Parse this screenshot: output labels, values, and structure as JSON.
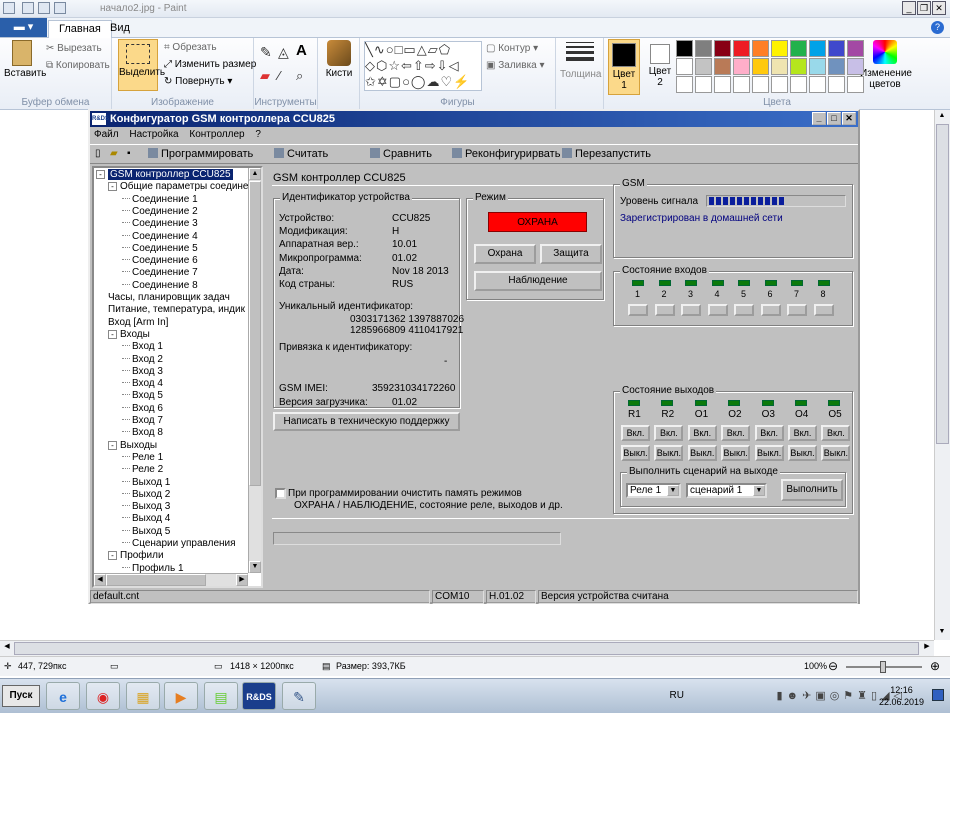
{
  "paint": {
    "title": "начало2.jpg - Paint",
    "file_tab": "▬ ▾",
    "tabs": [
      "Главная",
      "Вид"
    ],
    "clipboard": {
      "paste": "Вставить",
      "cut": "Вырезать",
      "copy": "Копировать",
      "group": "Буфер обмена"
    },
    "image": {
      "select": "Выделить",
      "crop": "Обрезать",
      "resize": "Изменить размер",
      "rotate": "Повернуть",
      "group": "Изображение"
    },
    "tools": {
      "group": "Инструменты",
      "brushes": "Кисти"
    },
    "shapes": {
      "group": "Фигуры",
      "outline": "Контур",
      "fill": "Заливка"
    },
    "size": "Толщина",
    "color1": {
      "label": "Цвет",
      "num": "1"
    },
    "color2": {
      "label": "Цвет",
      "num": "2"
    },
    "colors_group": "Цвета",
    "edit_colors": "Изменение цветов",
    "palette": [
      "#000000",
      "#7f7f7f",
      "#880015",
      "#ed1c24",
      "#ff7f27",
      "#fff200",
      "#22b14c",
      "#00a2e8",
      "#3f48cc",
      "#a349a4",
      "#ffffff",
      "#c3c3c3",
      "#b97a57",
      "#ffaec9",
      "#ffc90e",
      "#efe4b0",
      "#b5e61d",
      "#99d9ea",
      "#7092be",
      "#c8bfe7",
      "#ffffff",
      "#ffffff",
      "#ffffff",
      "#ffffff",
      "#ffffff",
      "#ffffff",
      "#ffffff",
      "#ffffff",
      "#ffffff",
      "#ffffff"
    ],
    "status": {
      "pos": "447, 729пкс",
      "size": "1418 × 1200пкс",
      "filesize": "Размер: 393,7КБ",
      "zoom": "100%"
    }
  },
  "taskbar": {
    "start": "Пуск",
    "lang": "RU",
    "time": "12:16",
    "date": "22.06.2019",
    "active_app": "R&DS"
  },
  "cfg": {
    "title": "Конфигуратор GSM контроллера CCU825",
    "menu": [
      "Файл",
      "Настройка",
      "Контроллер",
      "?"
    ],
    "toolbar": {
      "program": "Программировать",
      "read": "Считать",
      "compare": "Сравнить",
      "reconfigure": "Реконфигурирвать",
      "restart": "Перезапустить"
    },
    "tree": [
      {
        "t": "GSM контроллер CCU825",
        "lvl": 0,
        "sel": true,
        "exp": "-"
      },
      {
        "t": "Общие параметры соединени",
        "lvl": 1,
        "exp": "-"
      },
      {
        "t": "Соединение 1",
        "lvl": 2
      },
      {
        "t": "Соединение 2",
        "lvl": 2
      },
      {
        "t": "Соединение 3",
        "lvl": 2
      },
      {
        "t": "Соединение 4",
        "lvl": 2
      },
      {
        "t": "Соединение 5",
        "lvl": 2
      },
      {
        "t": "Соединение 6",
        "lvl": 2
      },
      {
        "t": "Соединение 7",
        "lvl": 2
      },
      {
        "t": "Соединение 8",
        "lvl": 2
      },
      {
        "t": "Часы, планировщик задач",
        "lvl": 1
      },
      {
        "t": "Питание, температура, индик",
        "lvl": 1
      },
      {
        "t": "Вход [Arm In]",
        "lvl": 1
      },
      {
        "t": "Входы",
        "lvl": 1,
        "exp": "-"
      },
      {
        "t": "Вход 1",
        "lvl": 2
      },
      {
        "t": "Вход 2",
        "lvl": 2
      },
      {
        "t": "Вход 3",
        "lvl": 2
      },
      {
        "t": "Вход 4",
        "lvl": 2
      },
      {
        "t": "Вход 5",
        "lvl": 2
      },
      {
        "t": "Вход 6",
        "lvl": 2
      },
      {
        "t": "Вход 7",
        "lvl": 2
      },
      {
        "t": "Вход 8",
        "lvl": 2
      },
      {
        "t": "Выходы",
        "lvl": 1,
        "exp": "-"
      },
      {
        "t": "Реле 1",
        "lvl": 2
      },
      {
        "t": "Реле 2",
        "lvl": 2
      },
      {
        "t": "Выход 1",
        "lvl": 2
      },
      {
        "t": "Выход 2",
        "lvl": 2
      },
      {
        "t": "Выход 3",
        "lvl": 2
      },
      {
        "t": "Выход 4",
        "lvl": 2
      },
      {
        "t": "Выход 5",
        "lvl": 2
      },
      {
        "t": "Сценарии управления",
        "lvl": 2
      },
      {
        "t": "Профили",
        "lvl": 1,
        "exp": "-"
      },
      {
        "t": "Профиль 1",
        "lvl": 2
      }
    ],
    "header": "GSM контроллер CCU825",
    "device": {
      "group": "Идентификатор устройства",
      "rows": [
        [
          "Устройство:",
          "CCU825"
        ],
        [
          "Модификация:",
          "H"
        ],
        [
          "Аппаратная вер.:",
          "10.01"
        ],
        [
          "Микропрограмма:",
          "01.02"
        ],
        [
          "Дата:",
          "Nov 18 2013"
        ],
        [
          "Код страны:",
          "RUS"
        ]
      ],
      "uid_label": "Уникальный идентификатор:",
      "uid1": "0303171362 1397887026",
      "uid2": "1285966809 4110417921",
      "bind_label": "Привязка к идентификатору:",
      "bind_value": "-",
      "imei_label": "GSM IMEI:",
      "imei": "359231034172260",
      "loader_label": "Версия загрузчика:",
      "loader": "01.02"
    },
    "support_btn": "Написать в техническую поддержку",
    "mode": {
      "group": "Режим",
      "state": "ОХРАНА",
      "state_color": "#ff0000",
      "guard": "Охрана",
      "protect": "Защита",
      "watch": "Наблюдение"
    },
    "gsm": {
      "group": "GSM",
      "signal_label": "Уровень сигнала",
      "signal_level": 0.55,
      "reg": "Зарегистрирован в домашней сети"
    },
    "inputs": {
      "group": "Состояние входов",
      "labels": [
        "1",
        "2",
        "3",
        "4",
        "5",
        "6",
        "7",
        "8"
      ]
    },
    "outputs": {
      "group": "Состояние выходов",
      "labels": [
        "R1",
        "R2",
        "O1",
        "O2",
        "O3",
        "O4",
        "O5"
      ],
      "on": "Вкл.",
      "off": "Выкл."
    },
    "scenario": {
      "group": "Выполнить сценарий на выходе",
      "relay": "Реле 1",
      "scenario": "сценарий 1",
      "run": "Выполнить"
    },
    "clear": {
      "line1": "При программировании очистить память режимов",
      "line2": "ОХРАНА / НАБЛЮДЕНИЕ, состояние реле, выходов и др."
    },
    "statusbar": {
      "file": "default.cnt",
      "port": "COM10",
      "ver": "H.01.02",
      "msg": "Версия устройства считана"
    }
  }
}
